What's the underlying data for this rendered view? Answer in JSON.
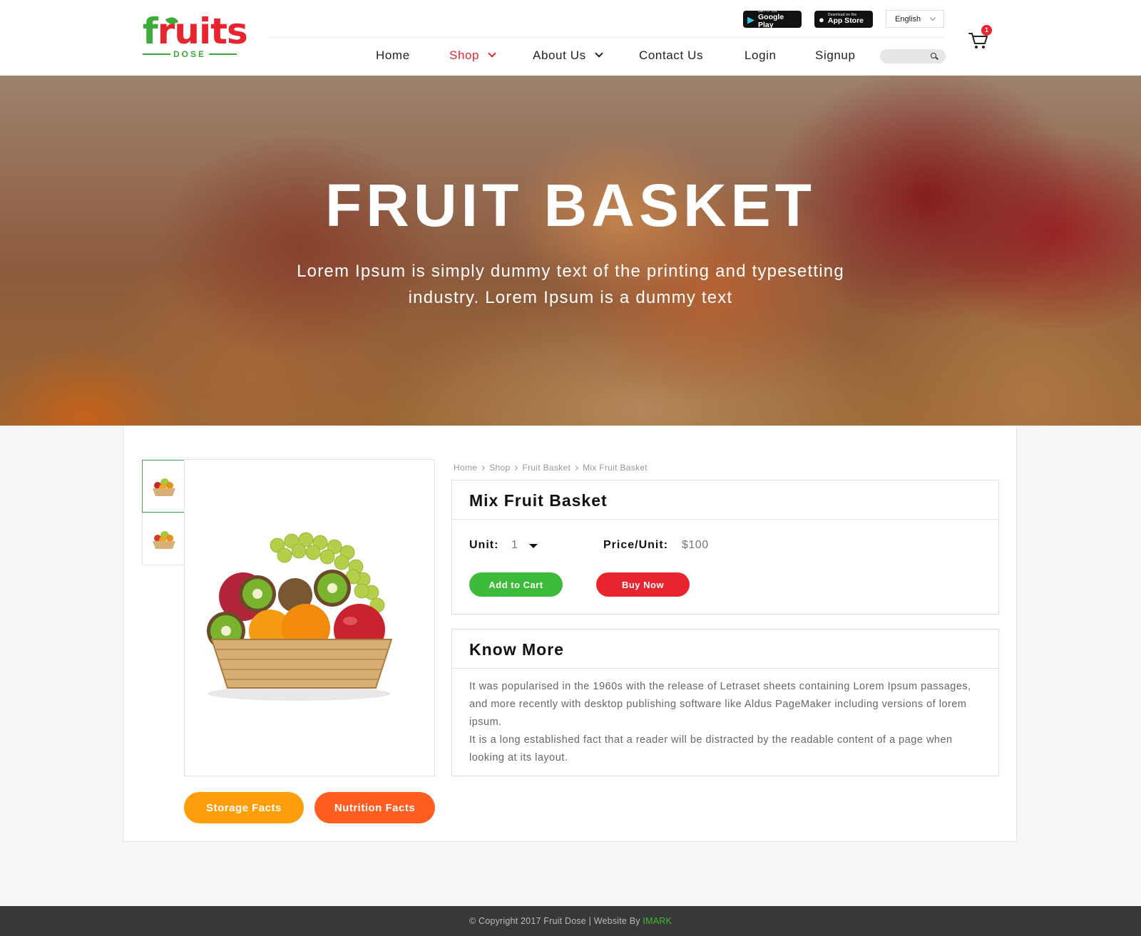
{
  "header": {
    "logo": {
      "word_first": "f",
      "word_rest": "ruits",
      "sub": "DOSE"
    },
    "google_play": {
      "small": "GET IT ON",
      "big": "Google Play"
    },
    "app_store": {
      "small": "Download on the",
      "big": "App Store"
    },
    "language": "English",
    "nav": [
      {
        "label": "Home",
        "active": false,
        "dropdown": false
      },
      {
        "label": "Shop",
        "active": true,
        "dropdown": true
      },
      {
        "label": "About Us",
        "active": false,
        "dropdown": true
      },
      {
        "label": "Contact Us",
        "active": false,
        "dropdown": false
      },
      {
        "label": "Login",
        "active": false,
        "dropdown": false
      },
      {
        "label": "Signup",
        "active": false,
        "dropdown": false
      }
    ],
    "search_placeholder": "",
    "cart_count": "1"
  },
  "hero": {
    "title": "FRUIT BASKET",
    "subtitle": "Lorem Ipsum is simply dummy text of the printing and typesetting industry. Lorem Ipsum is a dummy text"
  },
  "product": {
    "breadcrumb": [
      "Home",
      "Shop",
      "Fruit Basket",
      "Mix Fruit Basket"
    ],
    "name": "Mix Fruit Basket",
    "unit_label": "Unit:",
    "unit_value": "1",
    "price_label": "Price/Unit:",
    "price_value": "$100",
    "add_to_cart": "Add to Cart",
    "buy_now": "Buy Now",
    "storage_facts": "Storage Facts",
    "nutrition_facts": "Nutrition Facts"
  },
  "know_more": {
    "title": "Know More",
    "paragraphs": [
      "It was popularised in the 1960s with the release of Letraset sheets containing Lorem Ipsum passages, and more recently with desktop publishing software like Aldus PageMaker including versions of lorem ipsum.",
      "It is a long established fact that a reader will be distracted by the readable content of a page when looking at its layout."
    ]
  },
  "footer": {
    "copyright": "© Copyright 2017 Fruit Dose |  Website By ",
    "link": "IMARK"
  },
  "colors": {
    "brand_green": "#3cab3a",
    "brand_red": "#e8252f",
    "storage_orange": "#ff9d0b",
    "nutrition_orange": "#ff5e20"
  }
}
